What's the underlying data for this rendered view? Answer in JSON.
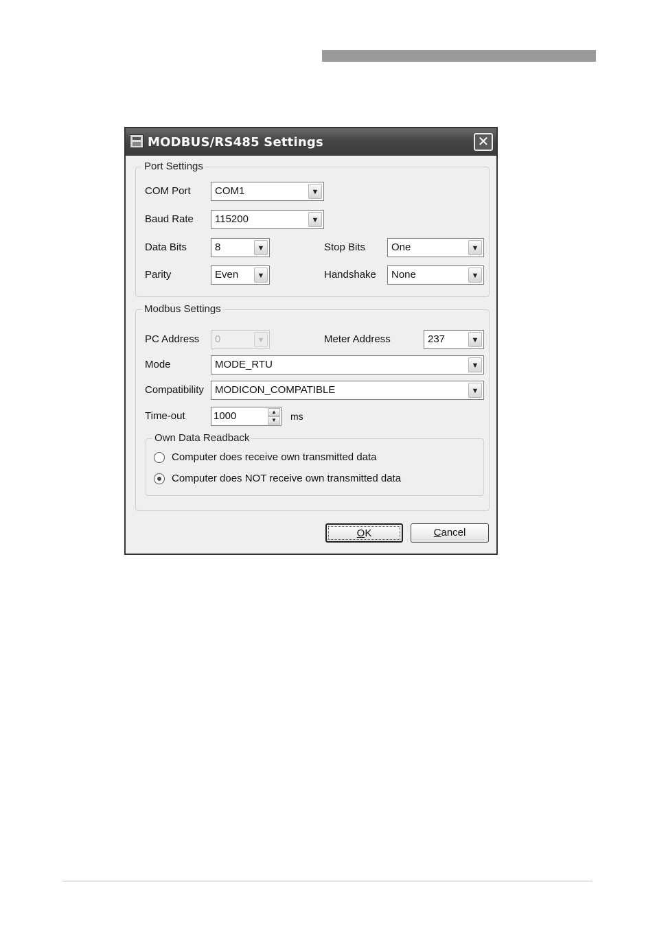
{
  "window": {
    "title": "MODBUS/RS485 Settings",
    "close_glyph": "✕"
  },
  "port_settings": {
    "group_label": "Port Settings",
    "com_port": {
      "label": "COM Port",
      "value": "COM1"
    },
    "baud_rate": {
      "label": "Baud Rate",
      "value": "115200"
    },
    "data_bits": {
      "label": "Data Bits",
      "value": "8"
    },
    "stop_bits": {
      "label": "Stop Bits",
      "value": "One"
    },
    "parity": {
      "label": "Parity",
      "value": "Even"
    },
    "handshake": {
      "label": "Handshake",
      "value": "None"
    }
  },
  "modbus_settings": {
    "group_label": "Modbus Settings",
    "pc_address": {
      "label": "PC Address",
      "value": "0",
      "enabled": false
    },
    "meter_address": {
      "label": "Meter Address",
      "value": "237"
    },
    "mode": {
      "label": "Mode",
      "value": "MODE_RTU"
    },
    "compatibility": {
      "label": "Compatibility",
      "value": "MODICON_COMPATIBLE"
    },
    "timeout": {
      "label": "Time-out",
      "value": "1000",
      "unit": "ms"
    },
    "readback": {
      "group_label": "Own Data Readback",
      "options": [
        {
          "label": "Computer does receive own transmitted data",
          "checked": false
        },
        {
          "label": "Computer does NOT receive own transmitted data",
          "checked": true
        }
      ]
    }
  },
  "buttons": {
    "ok_mnemonic": "O",
    "ok_rest": "K",
    "cancel_mnemonic": "C",
    "cancel_rest": "ancel"
  },
  "icons": {
    "dropdown": "▼",
    "spin_up": "▲",
    "spin_down": "▼"
  }
}
